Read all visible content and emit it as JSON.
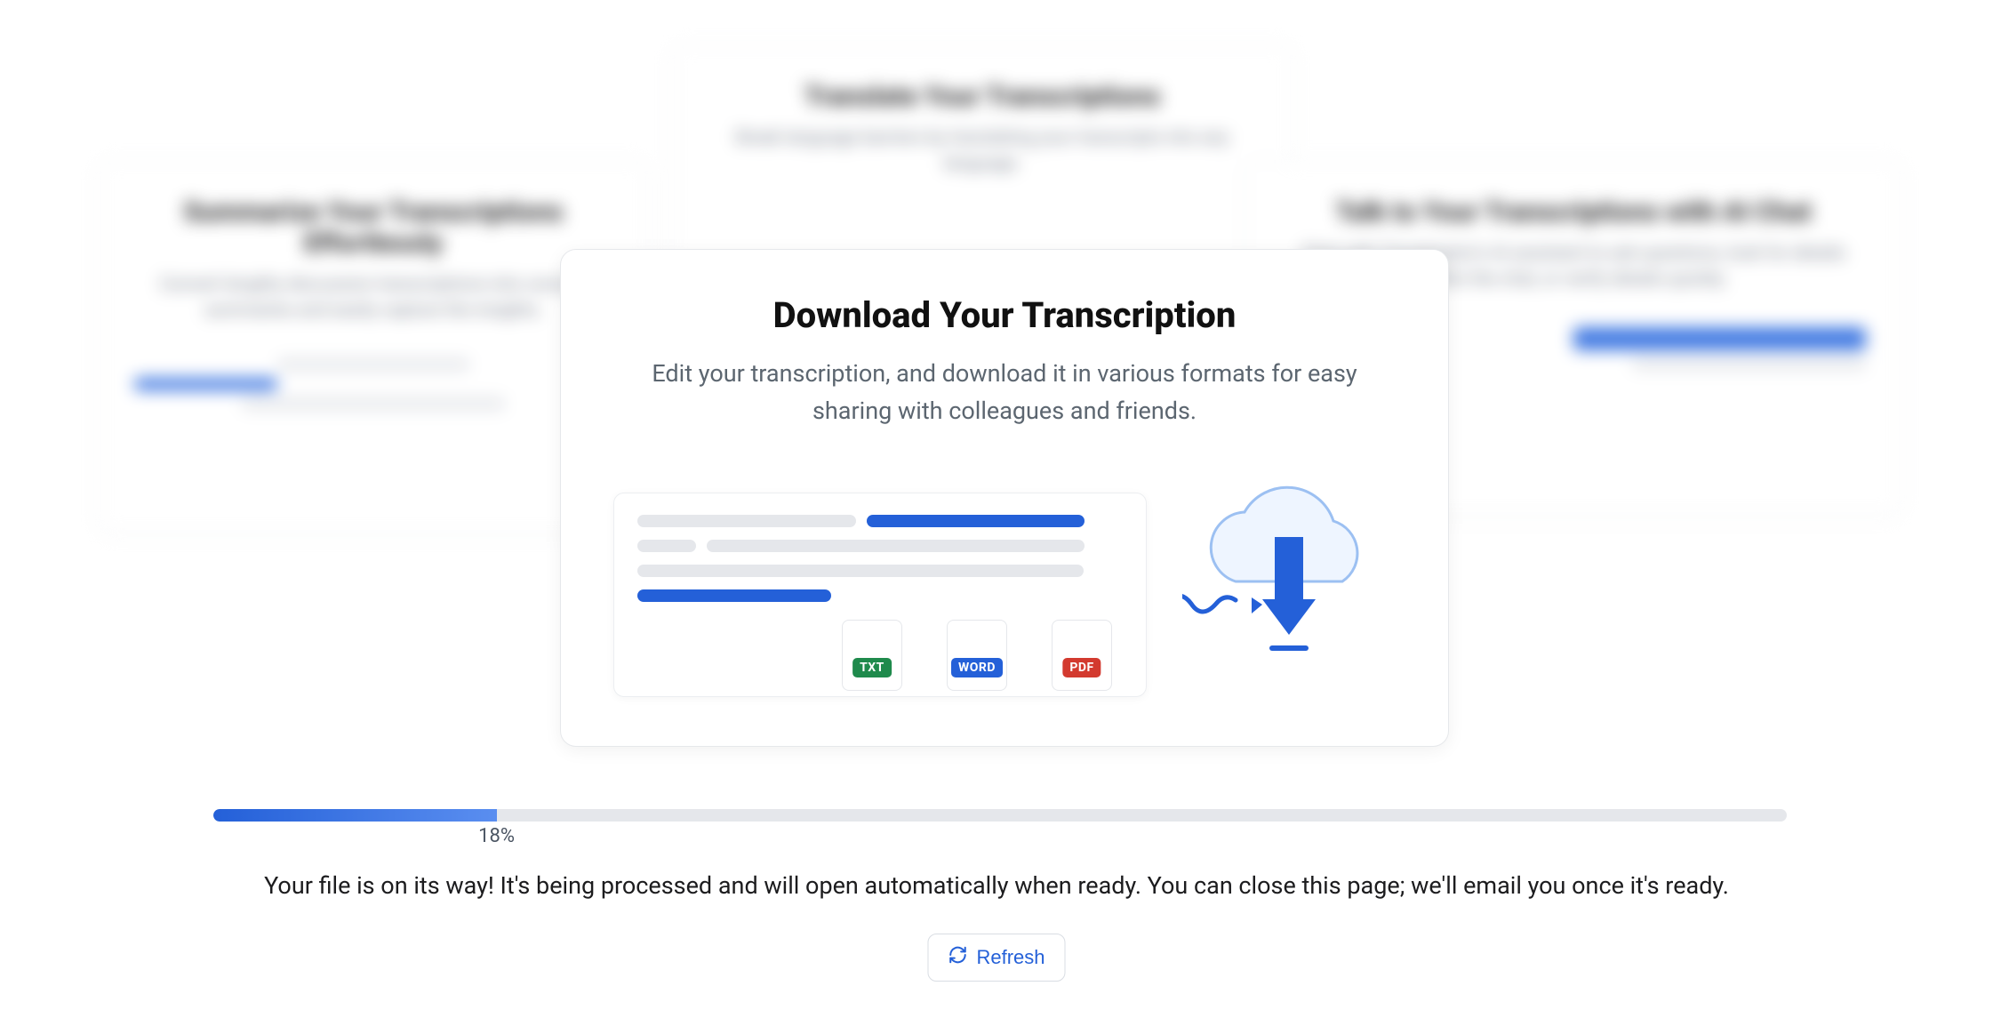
{
  "bg_cards": {
    "left": {
      "title": "Summarize Your Transcriptions Effortlessly",
      "desc": "Convert lengthy discussion transcriptions into concise summaries and easily capture the insights."
    },
    "top": {
      "title": "Translate Your Transcriptions",
      "desc": "Break language barriers by translating your transcripts into any language."
    },
    "right": {
      "title": "Talk to Your Transcriptions with AI Chat",
      "desc": "Chat with Transkriptor's AI assistant to ask questions, look for details within the chat, or verify details quickly."
    }
  },
  "main_card": {
    "title": "Download Your Transcription",
    "subtitle": "Edit your transcription, and download it in various formats for easy sharing with colleagues and friends.",
    "formats": {
      "txt": "TXT",
      "word": "WORD",
      "pdf": "PDF"
    }
  },
  "progress": {
    "percent": 18,
    "label": "18%"
  },
  "status_text": "Your file is on its way! It's being processed and will open automatically when ready. You can close this page; we'll email you once it's ready.",
  "refresh_label": "Refresh"
}
